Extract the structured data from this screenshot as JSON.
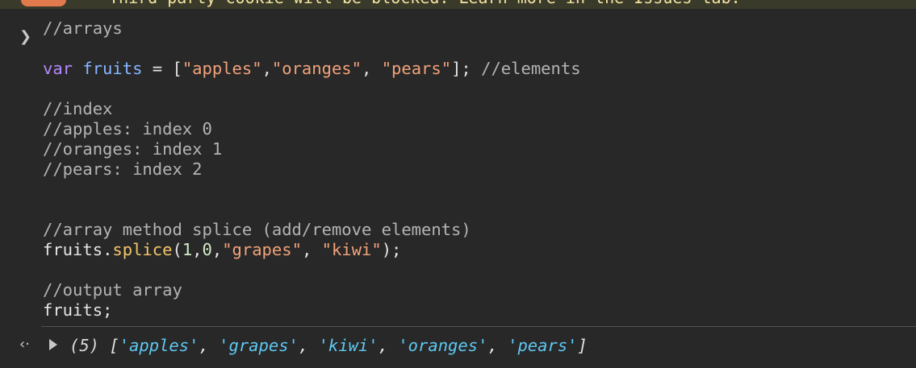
{
  "banner": {
    "text": "Third-party cookie will be blocked. Learn more in the Issues tab."
  },
  "console_input": {
    "prompt_icon": "chevron-right-icon",
    "lines": {
      "l1": {
        "comment": "//arrays"
      },
      "l3": {
        "keyword": "var",
        "name": "fruits",
        "assign": " = ",
        "open": "[",
        "s1": "\"apples\"",
        "sep1": ",",
        "s2": "\"oranges\"",
        "sep2": ", ",
        "s3": "\"pears\"",
        "close": "];",
        "comment": " //elements"
      },
      "l5": {
        "comment": "//index"
      },
      "l6": {
        "comment": "//apples: index 0"
      },
      "l7": {
        "comment": "//oranges: index 1"
      },
      "l8": {
        "comment": "//pears: index 2"
      },
      "l11": {
        "comment": "//array method splice (add/remove elements)"
      },
      "l12": {
        "object": "fruits",
        "dot": ".",
        "method": "splice",
        "open": "(",
        "n1": "1",
        "c1": ",",
        "n2": "0",
        "c2": ",",
        "s1": "\"grapes\"",
        "c3": ", ",
        "s2": "\"kiwi\"",
        "close": ");"
      },
      "l14": {
        "comment": "//output array"
      },
      "l15": {
        "text": "fruits;"
      }
    }
  },
  "console_output": {
    "return_icon": "return-arrow-icon",
    "expand_icon": "triangle-right-icon",
    "count": "(5)",
    "open": " [",
    "items": [
      "'apples'",
      "'grapes'",
      "'kiwi'",
      "'oranges'",
      "'pears'"
    ],
    "sep": ", ",
    "close": "]"
  },
  "colors": {
    "background": "#282828",
    "comment": "#b4b4b4",
    "keyword": "#b587ff",
    "variable": "#86b7ff",
    "string": "#f2a27a",
    "method": "#f3c669",
    "number": "#d3ecc8",
    "output_string": "#5ec8f2"
  }
}
